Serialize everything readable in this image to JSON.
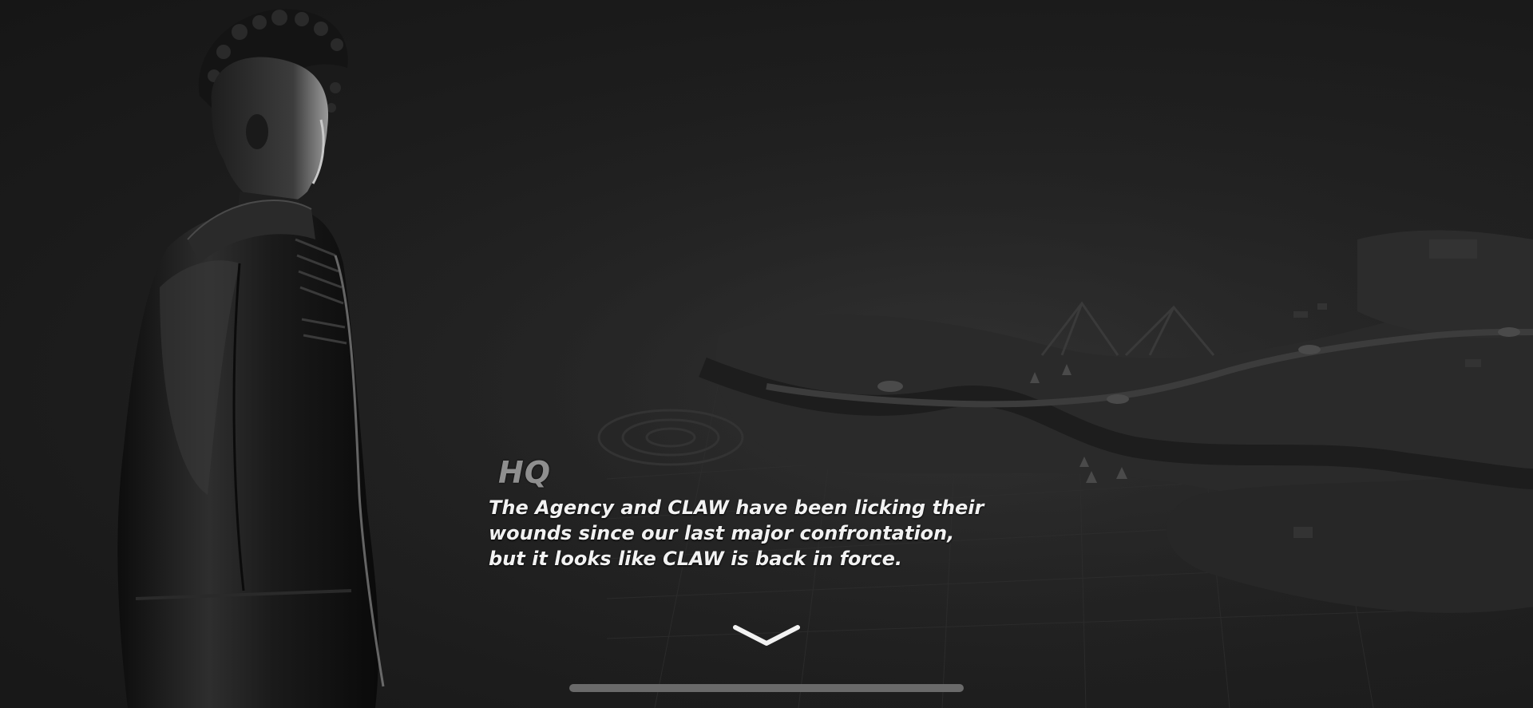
{
  "dialog": {
    "speaker": "HQ",
    "lines": [
      "The Agency and CLAW have been licking their",
      "wounds since our last major confrontation,",
      "but it looks like CLAW is back in force."
    ]
  },
  "icons": {
    "advance": "chevron-down-icon"
  },
  "colors": {
    "background": "#1c1c1c",
    "speaker_text": "#8f8f8f",
    "dialog_text": "#f2f2f2",
    "home_indicator": "#6a6a6a"
  }
}
